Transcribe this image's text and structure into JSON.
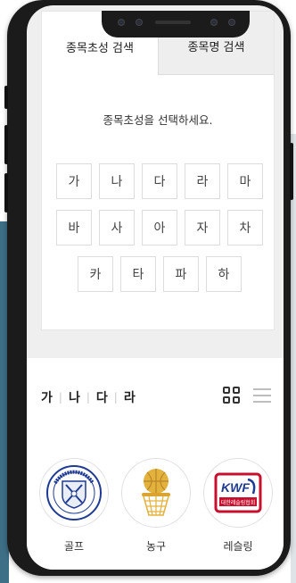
{
  "tabs": [
    {
      "label": "종목초성 검색",
      "active": true
    },
    {
      "label": "종목명 검색",
      "active": false
    }
  ],
  "hint": "종목초성을 선택하세요.",
  "consonants": {
    "row1": [
      "가",
      "나",
      "다",
      "라",
      "마"
    ],
    "row2": [
      "바",
      "사",
      "아",
      "자",
      "차"
    ],
    "row3": [
      "카",
      "타",
      "파",
      "하"
    ]
  },
  "filter": [
    "가",
    "나",
    "다",
    "라"
  ],
  "sports": [
    {
      "name": "골프",
      "icon": "golf-association-logo"
    },
    {
      "name": "농구",
      "icon": "basketball-hoop-logo"
    },
    {
      "name": "레슬링",
      "icon": "wrestling-federation-logo",
      "logo_text": "KWF",
      "logo_sub": "대한레슬링협회"
    }
  ],
  "colors": {
    "accent_red": "#c8102e",
    "accent_navy": "#1f3a93",
    "gold": "#e3b23c"
  }
}
